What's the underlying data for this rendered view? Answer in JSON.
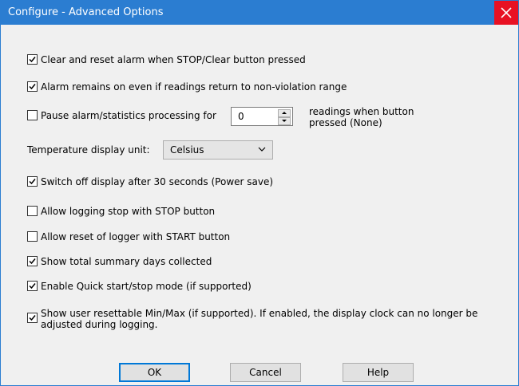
{
  "window": {
    "title": "Configure - Advanced Options",
    "close_icon": "close-icon"
  },
  "options": [
    {
      "label": "Clear and reset alarm when STOP/Clear button pressed",
      "checked": true
    },
    {
      "label": "Alarm remains on even if readings return to non-violation range",
      "checked": true
    },
    {
      "label": "Pause alarm/statistics processing for",
      "checked": false
    },
    {
      "label": "Switch off display after 30 seconds (Power save)",
      "checked": true
    },
    {
      "label": "Allow logging stop with STOP button",
      "checked": false
    },
    {
      "label": "Allow reset of logger with START button",
      "checked": false
    },
    {
      "label": "Show total summary days collected",
      "checked": true
    },
    {
      "label": "Enable Quick start/stop mode (if supported)",
      "checked": true
    },
    {
      "label": "Show user resettable Min/Max (if supported). If enabled, the display clock can no longer be adjusted during logging.",
      "checked": true
    }
  ],
  "pause": {
    "value": "0",
    "suffix": "readings when button pressed (None)"
  },
  "temperature": {
    "label": "Temperature display unit:",
    "value": "Celsius"
  },
  "buttons": {
    "ok": "OK",
    "cancel": "Cancel",
    "help": "Help"
  }
}
